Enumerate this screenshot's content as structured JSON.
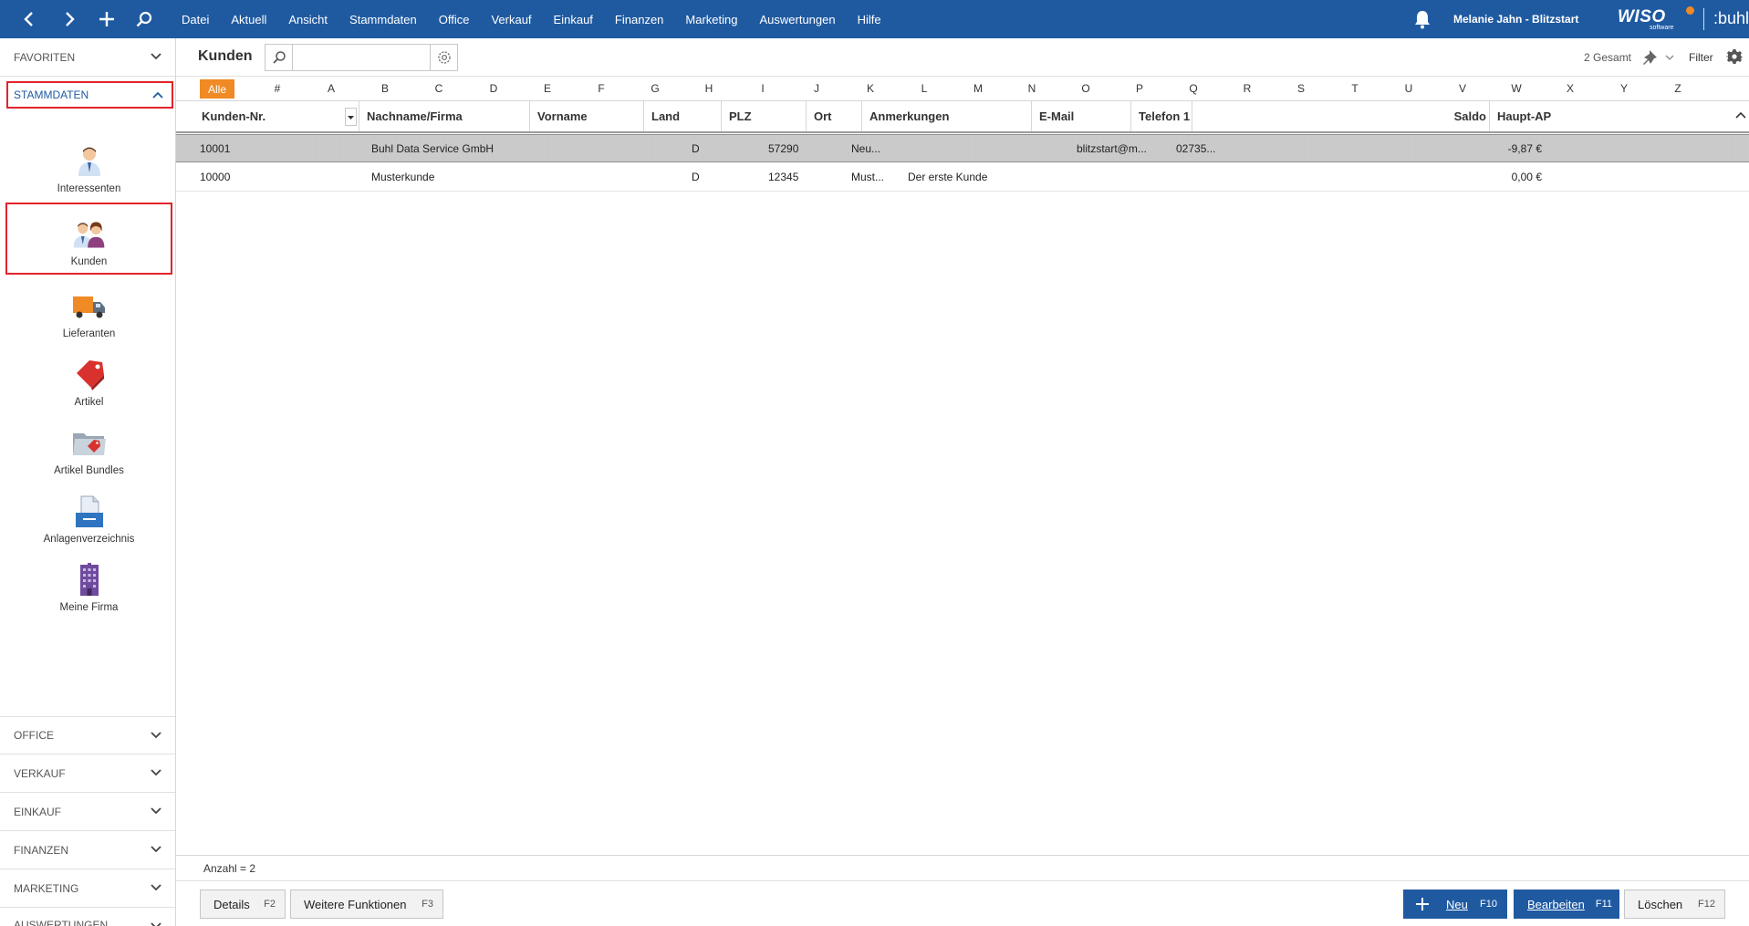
{
  "topbar": {
    "menu": [
      "Datei",
      "Aktuell",
      "Ansicht",
      "Stammdaten",
      "Office",
      "Verkauf",
      "Einkauf",
      "Finanzen",
      "Marketing",
      "Auswertungen",
      "Hilfe"
    ],
    "user": "Melanie Jahn - Blitzstart",
    "brand": "WISO",
    "brand_sub": "software",
    "brand2": ":buhl",
    "accent": "#1f5aa1"
  },
  "sidebar": {
    "favoriten": "FAVORITEN",
    "active_section": "STAMMDATEN",
    "items": [
      {
        "label": "Interessenten",
        "icon": "person-icon"
      },
      {
        "label": "Kunden",
        "icon": "customers-icon"
      },
      {
        "label": "Lieferanten",
        "icon": "truck-icon"
      },
      {
        "label": "Artikel",
        "icon": "tag-icon"
      },
      {
        "label": "Artikel Bundles",
        "icon": "folder-tag-icon"
      },
      {
        "label": "Anlagenverzeichnis",
        "icon": "document-tray-icon"
      },
      {
        "label": "Meine Firma",
        "icon": "building-icon"
      }
    ],
    "sections": [
      "OFFICE",
      "VERKAUF",
      "EINKAUF",
      "FINANZEN",
      "MARKETING",
      "AUSWERTUNGEN"
    ]
  },
  "main": {
    "title": "Kunden",
    "search_value": "",
    "total": "2 Gesamt",
    "filter": "Filter"
  },
  "alphabet": {
    "all": "Alle",
    "letters": [
      "#",
      "A",
      "B",
      "C",
      "D",
      "E",
      "F",
      "G",
      "H",
      "I",
      "J",
      "K",
      "L",
      "M",
      "N",
      "O",
      "P",
      "Q",
      "R",
      "S",
      "T",
      "U",
      "V",
      "W",
      "X",
      "Y",
      "Z"
    ]
  },
  "table": {
    "columns": [
      "Kunden-Nr.",
      "Nachname/Firma",
      "Vorname",
      "Land",
      "PLZ",
      "Ort",
      "Anmerkungen",
      "E-Mail",
      "Telefon 1",
      "Saldo",
      "Haupt-AP"
    ],
    "rows": [
      {
        "kunden_nr": "10001",
        "name": "Buhl Data Service GmbH",
        "vorname": "",
        "land": "D",
        "plz": "57290",
        "ort": "Neu...",
        "anmerkungen": "",
        "email": "blitzstart@m...",
        "telefon": "02735...",
        "saldo": "-9,87 €",
        "haupt_ap": ""
      },
      {
        "kunden_nr": "10000",
        "name": "Musterkunde",
        "vorname": "",
        "land": "D",
        "plz": "12345",
        "ort": "Must...",
        "anmerkungen": "Der erste Kunde",
        "email": "",
        "telefon": "",
        "saldo": "0,00 €",
        "haupt_ap": ""
      }
    ]
  },
  "footer": {
    "count": "Anzahl = 2",
    "buttons": {
      "details": {
        "label": "Details",
        "key": "F2"
      },
      "weitere": {
        "label": "Weitere Funktionen",
        "key": "F3"
      },
      "neu": {
        "label": "Neu",
        "key": "F10"
      },
      "bearbeiten": {
        "label": "Bearbeiten",
        "key": "F11"
      },
      "loeschen": {
        "label": "Löschen",
        "key": "F12"
      }
    }
  }
}
